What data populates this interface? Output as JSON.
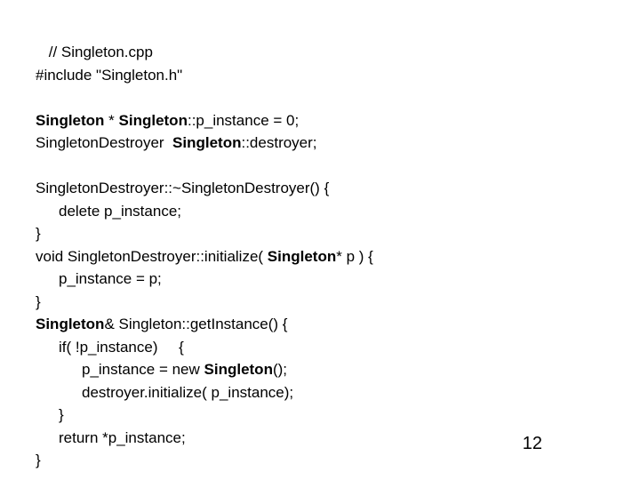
{
  "code": {
    "l1": " // Singleton.cpp",
    "l2": "#include \"Singleton.h\"",
    "l3": "",
    "l4a": "Singleton",
    "l4b": " * ",
    "l4c": "Singleton",
    "l4d": "::p_instance = 0;",
    "l5a": "SingletonDestroyer  ",
    "l5b": "Singleton",
    "l5c": "::destroyer;",
    "l6": "",
    "l7": "SingletonDestroyer::~SingletonDestroyer() {",
    "l8": "delete p_instance;",
    "l9": "}",
    "l10a": "void SingletonDestroyer::initialize( ",
    "l10b": "Singleton",
    "l10c": "* p ) {",
    "l11": "p_instance = p;",
    "l12": "}",
    "l13a": "Singleton",
    "l13b": "& Singleton::getInstance() {",
    "l14": "if( !p_instance)     {",
    "l15a": "p_instance = new ",
    "l15b": "Singleton",
    "l15c": "();",
    "l16": "destroyer.initialize( p_instance);",
    "l17": "}",
    "l18": "return *p_instance;",
    "l19": "}"
  },
  "page_number": "12"
}
